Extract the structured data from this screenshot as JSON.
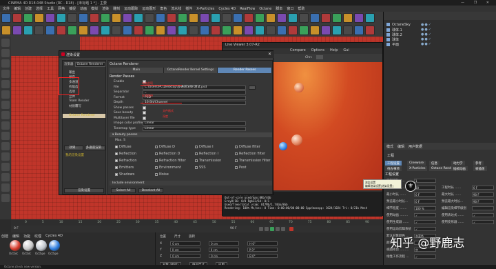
{
  "window": {
    "title": "CINEMA 4D R18.048 Studio (RC - R18) - [未标题 1 *] - 主要",
    "controls": "— ❐ ✕"
  },
  "menubar": [
    "文件",
    "编辑",
    "创建",
    "选择",
    "工具",
    "网格",
    "捕捉",
    "动画",
    "模拟",
    "渲染",
    "雕刻",
    "运动跟踪",
    "运动图形",
    "角色",
    "流水线",
    "插件",
    "X-Particles",
    "Cycles 4D",
    "RealFlow",
    "Octane",
    "脚本",
    "窗口",
    "帮助"
  ],
  "live_viewer": {
    "title": "Live Viewer 3.07-R2",
    "menu": [
      "Compare",
      "Options",
      "Help",
      "Gui"
    ],
    "chn_label": "Chn:",
    "stats": [
      "GPU: 1070(T2)[8.1]                 70.00     95°C",
      "Out-of-core used/max:0Kb/4Gb",
      "Grey8/16: 0/0           Rgb32/64: 0/1",
      "Used/free/total vram: 817Mb/1.74Gb/8Gb",
      "Rendering: 100%  Ms/sec: 0  Time: 0:00:00/00:00:00  Spp/maxspp: 1024/1024  Tri: 0/21k  Mesh"
    ]
  },
  "objects": {
    "rows": [
      "OctaneSky",
      "球体.1",
      "球体.2",
      "球体",
      "平面"
    ]
  },
  "attributes": {
    "menu": [
      "模式",
      "编辑",
      "用户数据"
    ],
    "title": "工程",
    "tabs": [
      "工程设置",
      "Cineware",
      "信息",
      "动力学",
      "参考",
      "待办事项",
      "X-Particles",
      "Octane Render",
      "插帧动画",
      "帧插值"
    ],
    "section": "工程设置",
    "rows": [
      {
        "label": "工程缩放 .....",
        "value": "1",
        "unit": "厘米"
      },
      {
        "label": "帧率(FPS) ......",
        "value": "30",
        "label2": "工程时长 ......",
        "value2": "0 F"
      },
      {
        "label": "最小时长 ......",
        "value": "0 F",
        "label2": "最大时长 ......",
        "value2": "90 F"
      },
      {
        "label": "预览最小时长...",
        "value": "0 F",
        "label2": "预览最大时长...",
        "value2": "90 F"
      },
      {
        "label": "细节程度 .......",
        "value": "100 %",
        "label2": "编辑渲染细节级别",
        "value2": ""
      },
      {
        "label": "使用动画 ........",
        "value": "✓",
        "label2": "使用表达式 ......",
        "value2": "✓"
      },
      {
        "label": "使用生成器 ......",
        "value": "✓",
        "label2": "使用变形器 ......",
        "value2": "✓"
      },
      {
        "label": "使用运动剪辑系统",
        "value": "✓",
        "label2": "",
        "value2": ""
      },
      {
        "label": "默认对象颜色 ...",
        "value": "灰蓝色",
        "label2": "",
        "value2": ""
      },
      {
        "label": "颜色 ..............",
        "value": "",
        "label2": "",
        "value2": ""
      },
      {
        "label": "视图修剪 .........",
        "value": "中",
        "label2": "",
        "value2": ""
      },
      {
        "label": "线性工作流程 ...",
        "value": "✓",
        "label2": "",
        "value2": ""
      }
    ]
  },
  "tooltip": {
    "lines": [
      "渲染设置",
      "编辑渲染设置[渲染设置]"
    ]
  },
  "timeline": {
    "ticks": [
      "0",
      "5",
      "10",
      "15",
      "20",
      "25",
      "30",
      "35",
      "40",
      "45",
      "50",
      "55",
      "60",
      "65",
      "70",
      "75",
      "80",
      "85",
      "90"
    ],
    "current": "0 F",
    "end": "90 F"
  },
  "materials": {
    "menu": [
      "创建",
      "编辑",
      "功能",
      "纹理",
      "Cycles 4D"
    ],
    "items": [
      {
        "name": "OctGlc",
        "color": "#d83a2a"
      },
      {
        "name": "OctGlc",
        "color": "#c7c7c7"
      },
      {
        "name": "OctSpe",
        "color": "#bfc5cc"
      },
      {
        "name": "OctSpe",
        "color": "#2d7de0"
      }
    ]
  },
  "coords": {
    "headers": [
      "位置",
      "尺寸",
      "旋转"
    ],
    "rows": [
      {
        "axis": "X",
        "p": "0 cm",
        "s": "0 cm",
        "r": "H 0°"
      },
      {
        "axis": "Y",
        "p": "0 cm",
        "s": "0 cm",
        "r": "P 0°"
      },
      {
        "axis": "Z",
        "p": "0 cm",
        "s": "0 cm",
        "r": "B 0°"
      }
    ],
    "mode": "对象 (相对)",
    "size_mode": "绝对尺寸",
    "apply": "应用"
  },
  "status": "Octane:check new version.",
  "dialog": {
    "title": "渲染设置",
    "renderer_label": "渲染器",
    "renderer_value": "Octane Renderer",
    "left_items": [
      {
        "label": "输出",
        "sel": false
      },
      {
        "label": "保存",
        "sel": false
      },
      {
        "label": "多通道",
        "sel": false
      },
      {
        "label": "抗锯齿",
        "sel": false
      },
      {
        "label": "选项",
        "sel": false
      },
      {
        "label": "立体",
        "sel": false
      },
      {
        "label": "Team Render",
        "sel": false
      },
      {
        "label": "材质覆写",
        "sel": false
      },
      {
        "label": "Octane Renderer",
        "sel": true
      }
    ],
    "btn_effects": "效果...",
    "btn_multipass": "多通道渲染...",
    "my_settings": "我的渲染设置",
    "btn_render_settings": "渲染设置",
    "right_title": "Octane Renderer",
    "tabs": [
      "Main",
      "OctaneRender Kernel Settings",
      "Render Passes"
    ],
    "active_tab": 2,
    "section": "Render Passes",
    "rows": [
      {
        "label": "Enable",
        "type": "check"
      },
      {
        "label": "File",
        "type": "value",
        "value": "C:\\Users\\PC\\Desktop\\多通道渲染\\测试.psd"
      },
      {
        "label": "Separator",
        "type": "value",
        "value": "_"
      },
      {
        "label": "Format",
        "type": "value",
        "value": "PSD"
      },
      {
        "label": "Depth",
        "type": "value",
        "value": "16 Bit/Channel"
      },
      {
        "label": "Show passes",
        "type": "check"
      },
      {
        "label": "Save beauty",
        "type": "check"
      },
      {
        "label": "Multilayer file",
        "type": "check"
      },
      {
        "label": "Image color profile",
        "type": "value",
        "value": "Linear"
      },
      {
        "label": "Tonemap type",
        "type": "value",
        "value": "Linear"
      }
    ],
    "group_beauty": "▾ Beauty passes",
    "max_samples": "Max. S",
    "passes": [
      [
        "Diffuse",
        "Diffuse D",
        "Diffuse I",
        "Diffuse filter"
      ],
      [
        "Reflection",
        "Reflection D",
        "Reflection I",
        "Reflection filter"
      ],
      [
        "Refraction",
        "Refraction filter",
        "Transmission",
        "Transmission filter"
      ],
      [
        "Emitters",
        "Environment",
        "SSS",
        "Post"
      ],
      [
        "Shadows",
        "Noise",
        "",
        ""
      ]
    ],
    "include_env": "Include environment",
    "btn_select_all": "Select All",
    "btn_deselect_all": "Deselect All",
    "annotations": [
      "勾选此项",
      "存储路径",
      "文件格式",
      "深度"
    ]
  },
  "watermark": "知乎 @野鹿志",
  "colors": {
    "accent": "#5f87b6",
    "viewport_red": "#c0352a",
    "annotation_red": "#ff2020"
  }
}
